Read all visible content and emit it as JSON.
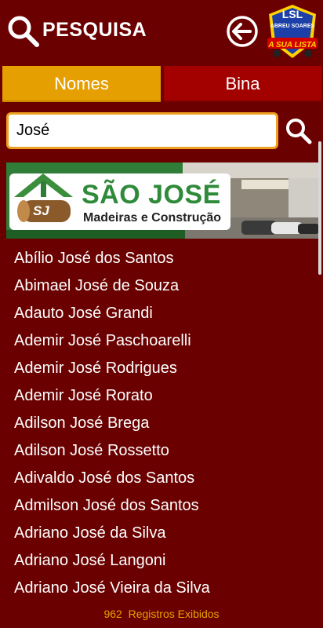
{
  "header": {
    "title": "PESQUISA",
    "logo": {
      "line1": "LSL",
      "line2": "ABREU SOARES",
      "line3": "A SUA LISTA"
    }
  },
  "tabs": [
    {
      "label": "Nomes",
      "active": true
    },
    {
      "label": "Bina",
      "active": false
    }
  ],
  "search": {
    "value": "José"
  },
  "banner": {
    "title": "SÃO JOSÉ",
    "subtitle": "Madeiras e Construção",
    "emblem": "SJ"
  },
  "results": [
    "Abílio José dos Santos",
    "Abimael José de Souza",
    "Adauto José Grandi",
    "Ademir José Paschoarelli",
    "Ademir José Rodrigues",
    "Ademir José Rorato",
    "Adilson José Brega",
    "Adilson José Rossetto",
    "Adivaldo José dos Santos",
    "Admilson José dos Santos",
    "Adriano José da Silva",
    "Adriano José Langoni",
    "Adriano José Vieira da Silva"
  ],
  "footer": {
    "count": "962",
    "label": "Registros Exibidos"
  },
  "colors": {
    "background": "#6b0000",
    "active_tab": "#e69f00",
    "inactive_tab": "#a30000",
    "accent": "#f0a020"
  }
}
